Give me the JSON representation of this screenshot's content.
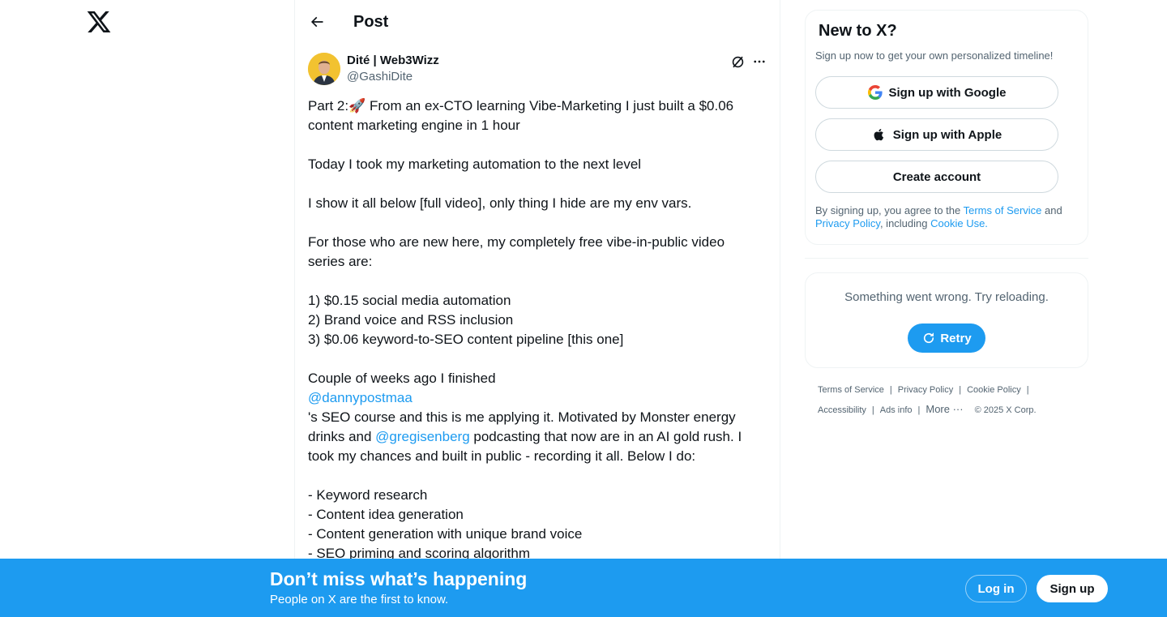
{
  "nav": {
    "logo_icon": "x-logo-icon"
  },
  "header": {
    "title": "Post",
    "back_icon": "arrow-left-icon"
  },
  "tweet": {
    "author_name": "Dité | Web3Wizz",
    "author_handle": "@GashiDite",
    "lines": [
      "Part 2:🚀 From an ex-CTO learning Vibe-Marketing I just built a $0.06",
      "content marketing engine in 1 hour",
      "",
      "Today I took my marketing automation to the next level",
      "",
      "I show it all below [full video], only thing I hide are my env vars.",
      "",
      "For those who are new here, my completely free vibe-in-public video",
      "series are:",
      "",
      "1) $0.15 social media automation",
      "2) Brand voice and RSS inclusion",
      "3) $0.06 keyword-to-SEO content pipeline [this one]",
      "",
      "Couple of weeks ago I finished",
      "@dannypostmaa",
      "'s SEO course and this is me applying it. Motivated by Monster energy",
      "drinks and ",
      "@gregisenberg",
      " podcasting that now are in an AI gold rush. I",
      "took my chances and built in public - recording it all. Below I do:",
      "",
      " - Keyword research",
      " - Content idea generation",
      " - Content generation with unique brand voice",
      " - SEO priming and scoring algorithm"
    ]
  },
  "sidebar": {
    "new_title": "New to X?",
    "new_subtitle": "Sign up now to get your own personalized timeline!",
    "google_label": "Sign up with Google",
    "apple_label": "Sign up with Apple",
    "create_label": "Create account",
    "terms_prefix": "By signing up, you agree to the ",
    "terms_link": "Terms of Service",
    "terms_and": " and",
    "privacy_link": "Privacy Policy",
    "terms_including": ", including ",
    "cookie_link": "Cookie Use.",
    "error_text": "Something went wrong. Try reloading.",
    "retry_label": "Retry"
  },
  "footer": {
    "links": [
      "Terms of Service",
      "Privacy Policy",
      "Cookie Policy",
      "Accessibility",
      "Ads info"
    ],
    "more": "More ···",
    "copyright": "© 2025 X Corp."
  },
  "banner": {
    "title": "Don’t miss what’s happening",
    "subtitle": "People on X are the first to know.",
    "login_label": "Log in",
    "signup_label": "Sign up"
  },
  "colors": {
    "accent": "#1d9bf0",
    "text": "#0f1419",
    "muted": "#536471",
    "border": "#eff3f4"
  }
}
